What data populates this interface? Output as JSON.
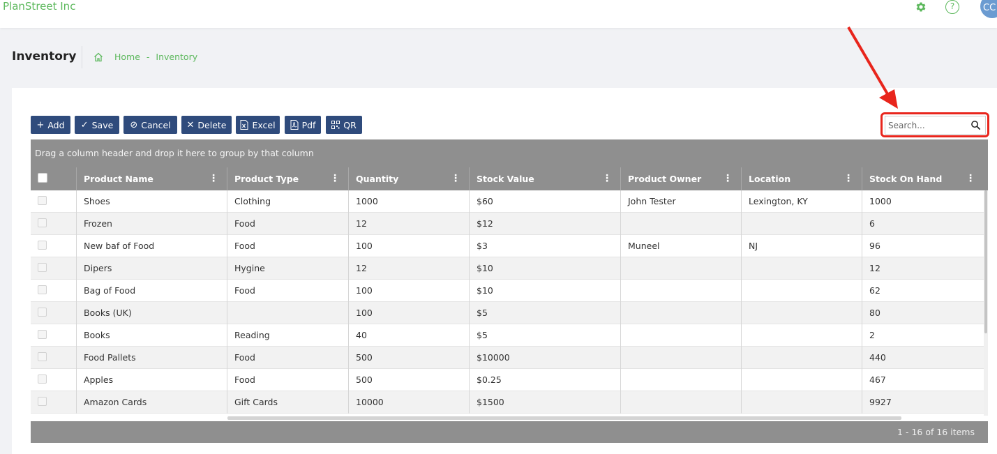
{
  "app": {
    "brand": "PlanStreet Inc",
    "avatar_initials": "CC"
  },
  "icons": {
    "settings": "gear-icon",
    "help": "help-circle-icon",
    "home": "home-icon",
    "search": "search-icon"
  },
  "colors": {
    "brand_green": "#5cb85c",
    "toolbar_button": "#2f4b7c",
    "grid_header": "#8f8f8f",
    "highlight": "#e8251c"
  },
  "page": {
    "title": "Inventory"
  },
  "breadcrumb": {
    "home": "Home",
    "separator": "-",
    "current": "Inventory"
  },
  "toolbar": {
    "add": "Add",
    "save": "Save",
    "cancel": "Cancel",
    "delete": "Delete",
    "excel": "Excel",
    "pdf": "Pdf",
    "qr": "QR"
  },
  "search": {
    "placeholder": "Search..."
  },
  "grid": {
    "group_hint": "Drag a column header and drop it here to group by that column",
    "columns": [
      "Product Name",
      "Product Type",
      "Quantity",
      "Stock Value",
      "Product Owner",
      "Location",
      "Stock On Hand"
    ],
    "rows": [
      [
        "Shoes",
        "Clothing",
        "1000",
        "$60",
        "John Tester",
        "Lexington, KY",
        "1000"
      ],
      [
        "Frozen",
        "Food",
        "12",
        "$12",
        "",
        "",
        "6"
      ],
      [
        "New baf of Food",
        "Food",
        "100",
        "$3",
        "Muneel",
        "NJ",
        "96"
      ],
      [
        "Dipers",
        "Hygine",
        "12",
        "$10",
        "",
        "",
        "12"
      ],
      [
        "Bag of Food",
        "Food",
        "100",
        "$10",
        "",
        "",
        "62"
      ],
      [
        "Books (UK)",
        "",
        "100",
        "$5",
        "",
        "",
        "80"
      ],
      [
        "Books",
        "Reading",
        "40",
        "$5",
        "",
        "",
        "2"
      ],
      [
        "Food Pallets",
        "Food",
        "500",
        "$10000",
        "",
        "",
        "440"
      ],
      [
        "Apples",
        "Food",
        "500",
        "$0.25",
        "",
        "",
        "467"
      ],
      [
        "Amazon Cards",
        "Gift Cards",
        "10000",
        "$1500",
        "",
        "",
        "9927"
      ]
    ],
    "pager_info": "1 - 16 of 16 items"
  }
}
